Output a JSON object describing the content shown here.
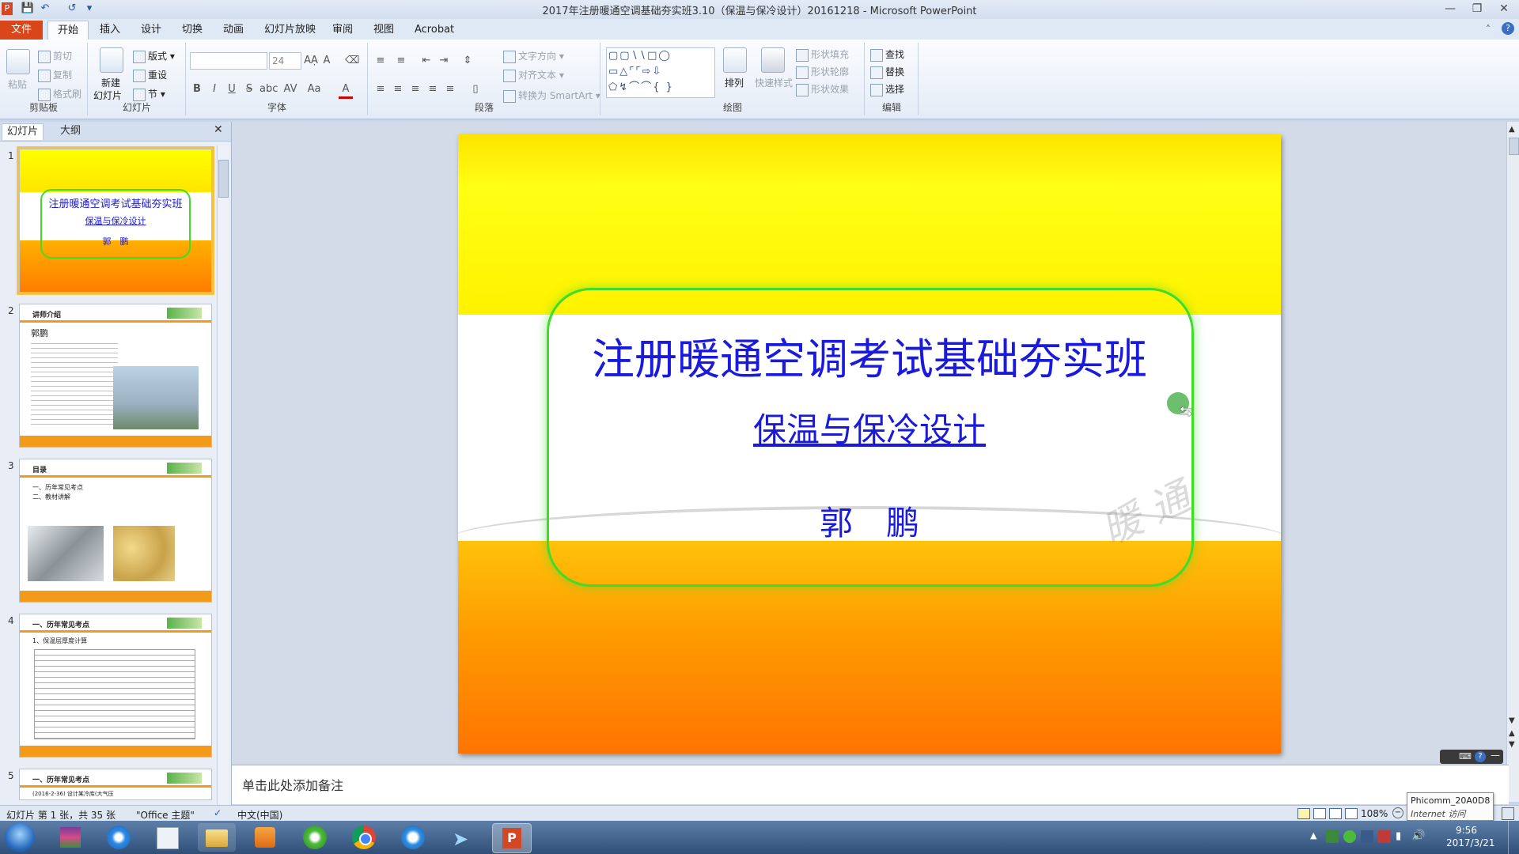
{
  "window": {
    "title": "2017年注册暖通空调基础夯实班3.10（保温与保冷设计）20161218 - Microsoft PowerPoint",
    "app_letter": "P"
  },
  "tabs": [
    "文件",
    "开始",
    "插入",
    "设计",
    "切换",
    "动画",
    "幻灯片放映",
    "审阅",
    "视图",
    "Acrobat"
  ],
  "ribbon": {
    "clipboard": {
      "label": "剪贴板",
      "paste": "粘贴",
      "cut": "剪切",
      "copy": "复制",
      "format_painter": "格式刷"
    },
    "slides": {
      "label": "幻灯片",
      "new_slide_1": "新建",
      "new_slide_2": "幻灯片",
      "layout": "版式",
      "reset": "重设",
      "section": "节"
    },
    "font": {
      "label": "字体",
      "size": "24"
    },
    "paragraph": {
      "label": "段落",
      "text_direction": "文字方向",
      "align_text": "对齐文本",
      "smartart": "转换为 SmartArt"
    },
    "drawing": {
      "label": "绘图",
      "arrange": "排列",
      "quick_styles": "快速样式",
      "shape_fill": "形状填充",
      "shape_outline": "形状轮廓",
      "shape_effects": "形状效果"
    },
    "editing": {
      "label": "编辑",
      "find": "查找",
      "replace": "替换",
      "select": "选择"
    }
  },
  "left_pane": {
    "tabs": [
      "幻灯片",
      "大纲"
    ],
    "thumbs": [
      {
        "num": "1",
        "title": "注册暖通空调考试基础夯实班",
        "subtitle": "保温与保冷设计",
        "author": "郭　鹏"
      },
      {
        "num": "2",
        "title": "讲师介绍",
        "name": "郭鹏"
      },
      {
        "num": "3",
        "title": "目录",
        "items": [
          "一、历年常见考点",
          "二、教材讲解"
        ]
      },
      {
        "num": "4",
        "title": "一、历年常见考点",
        "sub": "1、保温层厚度计算"
      },
      {
        "num": "5",
        "title": "一、历年常见考点",
        "sub": "(2016-2-36) 设计某冷库(大气压"
      }
    ]
  },
  "slide": {
    "title": "注册暖通空调考试基础夯实班",
    "subtitle": "保温与保冷设计",
    "author": "郭　鹏",
    "watermark": "暖 通"
  },
  "notes": {
    "placeholder": "单击此处添加备注"
  },
  "status": {
    "slide_info": "幻灯片 第 1 张，共 35 张",
    "theme": "\"Office 主题\"",
    "language": "中文(中国)",
    "zoom": "108%"
  },
  "tooltip": {
    "line1": "Phicomm_20A0D8",
    "line2": "Internet 访问"
  },
  "clock": {
    "time": "9:56",
    "date": "2017/3/21"
  },
  "colors": {
    "accent": "#d9461a",
    "slide_title": "#1a1adc",
    "frame": "#3fdc2a"
  }
}
